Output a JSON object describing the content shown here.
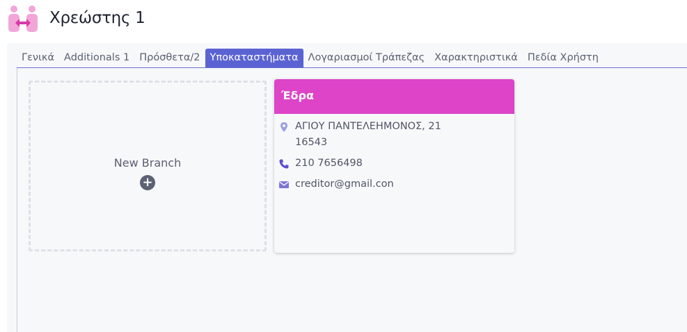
{
  "header": {
    "title": "Χρεώστης 1"
  },
  "tabs": [
    {
      "label": "Γενικά",
      "active": false
    },
    {
      "label": "Additionals 1",
      "active": false
    },
    {
      "label": "Πρόσθετα/2",
      "active": false
    },
    {
      "label": "Υποκαταστήματα",
      "active": true
    },
    {
      "label": "Λογαριασμοί Τράπεζας",
      "active": false
    },
    {
      "label": "Χαρακτηριστικά",
      "active": false
    },
    {
      "label": "Πεδία Χρήστη",
      "active": false
    }
  ],
  "new_branch": {
    "label": "New Branch",
    "plus_glyph": "+"
  },
  "branch_card": {
    "title": "Έδρα",
    "address_line1": "ΑΓΙΟΥ ΠΑΝΤΕΛΕΗΜΟΝΟΣ, 21",
    "address_line2": "16543",
    "phone": "210 7656498",
    "email": "creditor@gmail.con"
  },
  "colors": {
    "accent": "#5b63d3",
    "card_header": "#dd44c8",
    "logo": "#f2a6d8"
  },
  "icons": {
    "logo": "handshake-people-icon",
    "address": "map-pin-icon",
    "phone": "phone-icon",
    "email": "envelope-icon",
    "add": "plus-circle-icon"
  }
}
